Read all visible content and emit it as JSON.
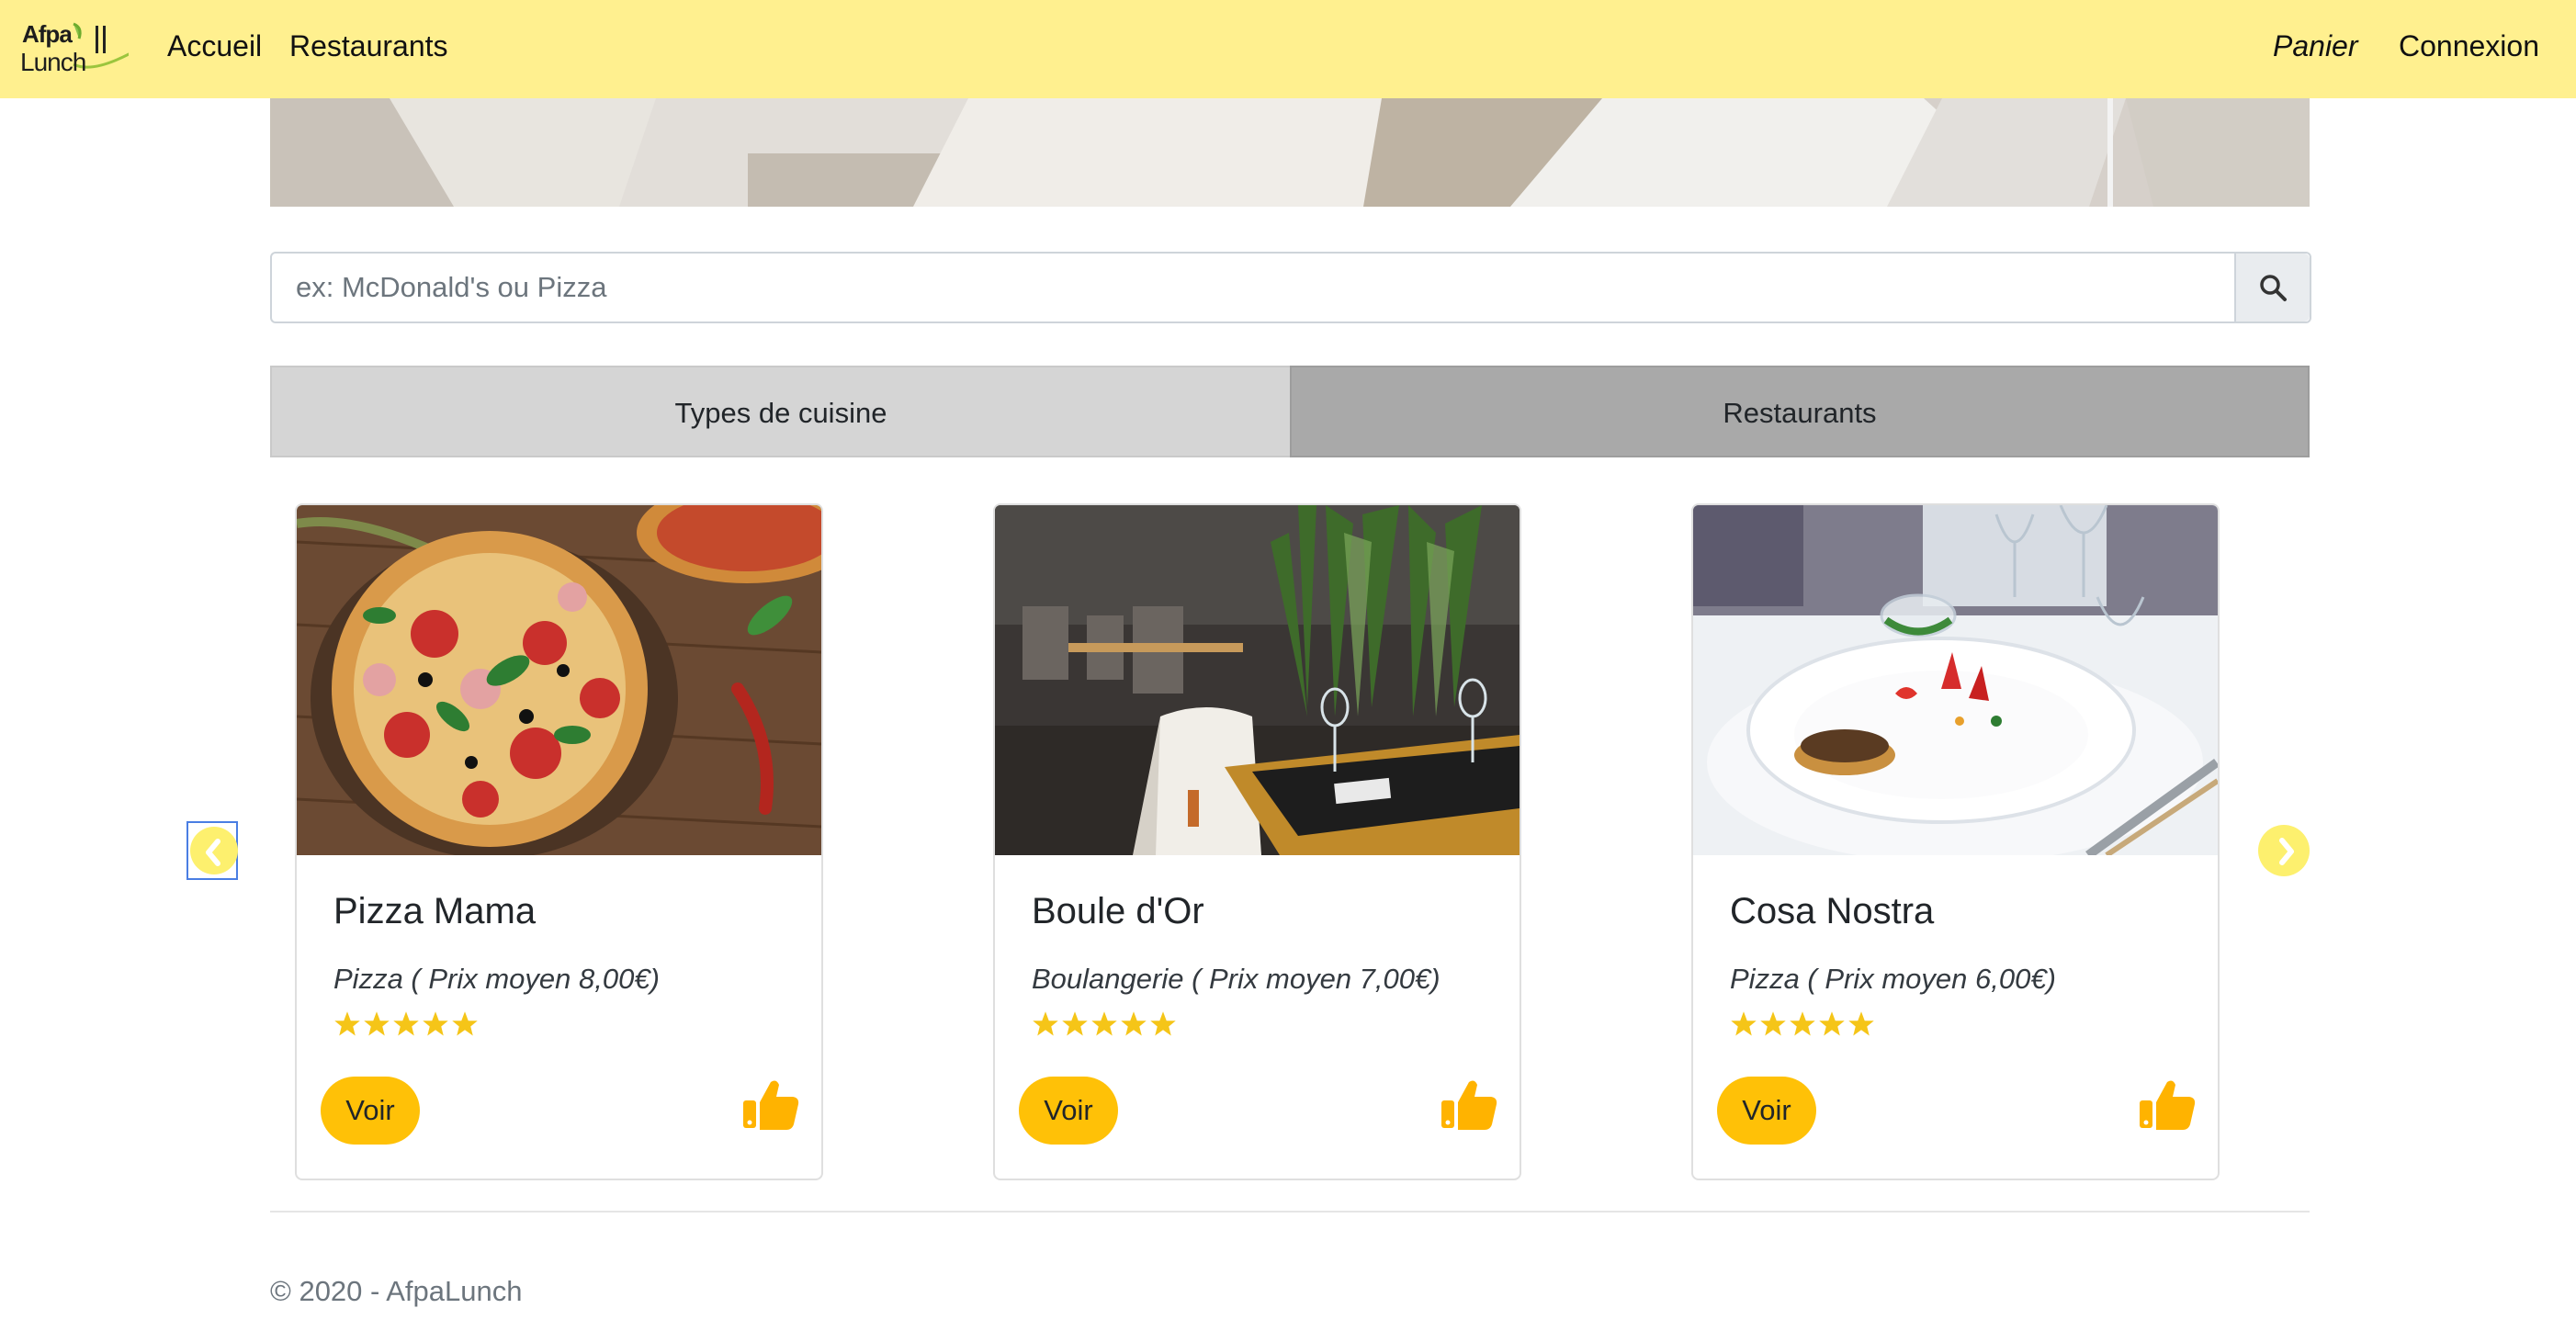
{
  "navbar": {
    "logo_line1": "Afpa",
    "logo_line2": "Lunch",
    "links": {
      "accueil": "Accueil",
      "restaurants": "Restaurants",
      "panier": "Panier",
      "connexion": "Connexion"
    },
    "background_color": "#fff08f"
  },
  "search": {
    "placeholder": "ex: McDonald's ou Pizza",
    "button_icon": "search-icon"
  },
  "tabs": [
    {
      "label": "Types de cuisine"
    },
    {
      "label": "Restaurants",
      "active": true
    }
  ],
  "carousel": {
    "prev_icon": "chevron-left-icon",
    "next_icon": "chevron-right-icon",
    "cards": [
      {
        "title": "Pizza Mama",
        "subtitle": "Pizza ( Prix moyen 8,00€)",
        "rating": 5,
        "button_label": "Voir",
        "image_subject": "pizza"
      },
      {
        "title": "Boule d'Or",
        "subtitle": "Boulangerie ( Prix moyen 7,00€)",
        "rating": 5,
        "button_label": "Voir",
        "image_subject": "restaurant interior"
      },
      {
        "title": "Cosa Nostra",
        "subtitle": "Pizza ( Prix moyen 6,00€)",
        "rating": 5,
        "button_label": "Voir",
        "image_subject": "plated dish"
      }
    ]
  },
  "footer": {
    "text": "© 2020 - AfpaLunch"
  },
  "colors": {
    "accent": "#ffc107",
    "star": "#f5c518",
    "tab_inactive": "#d5d5d5",
    "tab_active": "#a9a9a9"
  }
}
